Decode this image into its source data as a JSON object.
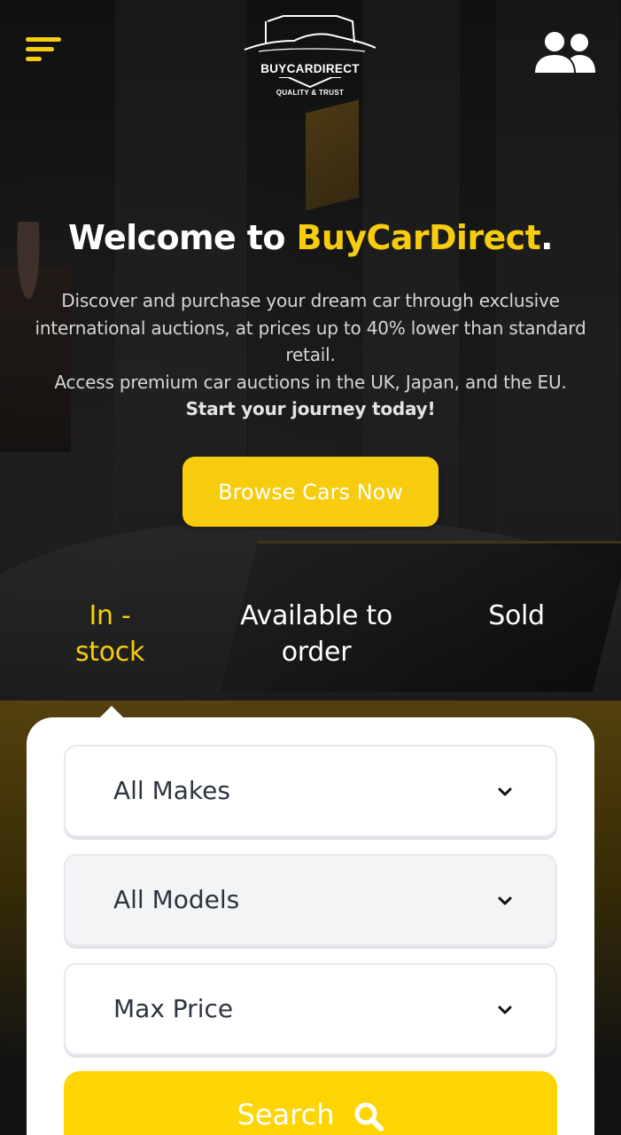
{
  "header": {
    "logo_word": "BUYCARDIRECT",
    "logo_tagline": "QUALITY & TRUST",
    "menu_icon": "hamburger-menu-icon",
    "account_icon": "users-icon"
  },
  "hero": {
    "title_prefix": "Welcome to ",
    "title_brand": "BuyCarDirect",
    "title_suffix": ".",
    "line1": "Discover and purchase your dream car through exclusive international auctions, at prices up to 40% lower than standard retail.",
    "line2": "Access premium car auctions in the UK, Japan, and the EU.",
    "line3": "Start your journey today!",
    "cta_label": "Browse Cars Now"
  },
  "tabs": [
    {
      "label": "In - stock",
      "active": true
    },
    {
      "label": "Available to order",
      "active": false
    },
    {
      "label": "Sold",
      "active": false
    }
  ],
  "search": {
    "make_value": "All Makes",
    "model_value": "All Models",
    "price_value": "Max Price",
    "button_label": "Search",
    "button_icon": "search-icon"
  },
  "colors": {
    "accent": "#f7cc0f",
    "search_button": "#fdd505",
    "panel": "#ffffff",
    "select_text": "#2d3440"
  }
}
